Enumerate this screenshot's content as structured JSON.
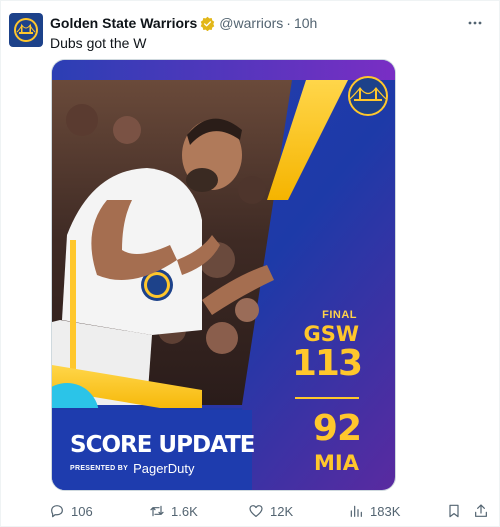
{
  "account": {
    "display_name": "Golden State Warriors",
    "handle": "@warriors",
    "separator": "·",
    "time": "10h",
    "verified_icon": "verified-badge-icon",
    "avatar_icon": "warriors-logo-icon"
  },
  "tweet": {
    "text": "Dubs got the W"
  },
  "graphic": {
    "status": "FINAL",
    "home_team": "GSW",
    "home_score": "113",
    "away_score": "92",
    "away_team": "MIA",
    "headline": "SCORE UPDATE",
    "presented_by": "PRESENTED BY",
    "sponsor": "PagerDuty",
    "colors": {
      "royal_blue": "#1d428a",
      "gold": "#ffc72c",
      "purple": "#4b2d9a",
      "cyan": "#2bc4e8"
    }
  },
  "actions": {
    "reply_count": "106",
    "repost_count": "1.6K",
    "like_count": "12K",
    "views_count": "183K"
  }
}
